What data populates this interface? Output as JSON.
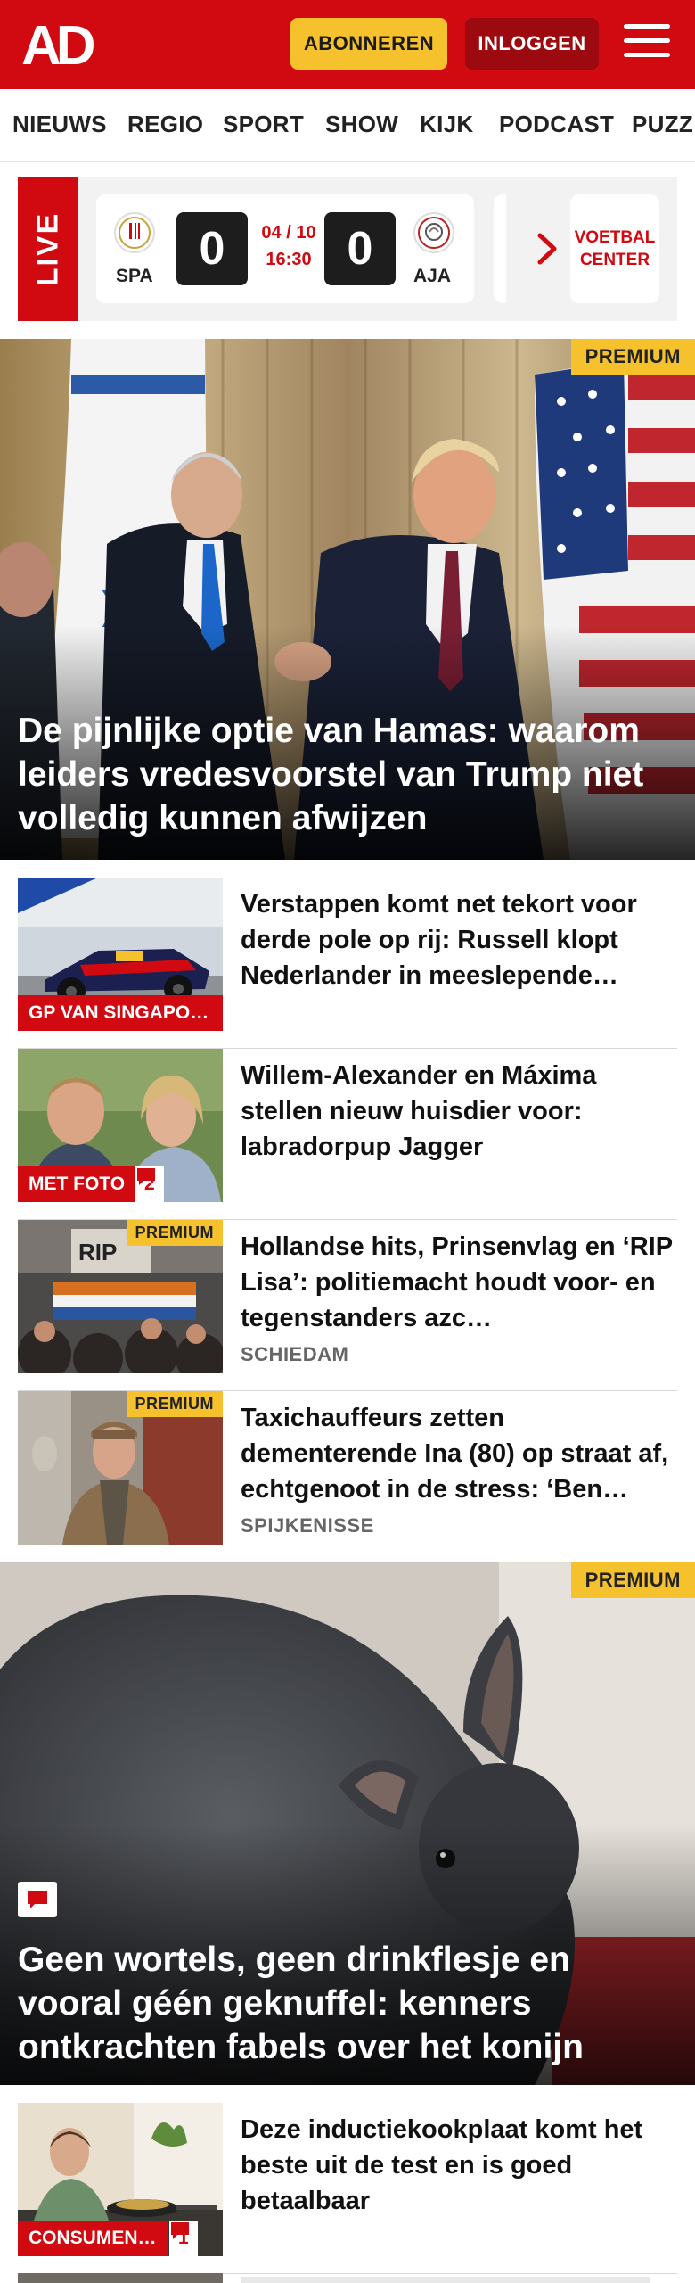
{
  "header": {
    "logo_text": "AD",
    "subscribe_label": "ABONNEREN",
    "login_label": "INLOGGEN",
    "menu_icon": "hamburger-menu-icon",
    "brand_color": "#d10a11",
    "accent_color": "#f5c22e"
  },
  "nav": {
    "items": [
      "NIEUWS",
      "REGIO",
      "SPORT",
      "SHOW",
      "KIJK",
      "PODCAST",
      "PUZZ"
    ]
  },
  "live": {
    "tab_label": "LIVE",
    "match": {
      "home": "SPA",
      "away": "AJA",
      "home_score": "0",
      "away_score": "0",
      "date": "04 / 10",
      "time": "16:30"
    },
    "football_center_label": "VOETBAL CENTER"
  },
  "hero": {
    "badge": "PREMIUM",
    "title": "De pijnlijke optie van Hamas: waarom leiders vredesvoorstel van Trump niet volledig kunnen afwijzen"
  },
  "articles": [
    {
      "title": "Verstappen komt net tekort voor derde pole op rij: Russell klopt Nederlander in meeslepende…",
      "label": "GP VAN SINGAPO…",
      "premium": "",
      "comments": "",
      "location": ""
    },
    {
      "title": "Willem-Alexander en Máxima stellen nieuw huisdier voor: labradorpup Jagger",
      "label": "MET FOTO",
      "premium": "",
      "comments": "2",
      "location": ""
    },
    {
      "title": "Hollandse hits, Prinsenvlag en ‘RIP Lisa’: politiemacht houdt voor- en tegenstanders azc…",
      "label": "",
      "premium": "PREMIUM",
      "comments": "",
      "location": "SCHIEDAM"
    },
    {
      "title": "Taxichauffeurs zetten dementerende Ina (80) op straat af, echtgenoot in de stress: ‘Ben…",
      "label": "",
      "premium": "PREMIUM",
      "comments": "",
      "location": "SPIJKENISSE"
    }
  ],
  "hero2": {
    "badge": "PREMIUM",
    "title": "Geen wortels, geen drinkflesje en vooral géén geknuffel: kenners ontkrachten fabels over het konijn"
  },
  "article_last": {
    "title": "Deze inductiekookplaat komt het beste uit de test en is goed betaalbaar",
    "label": "CONSUMEN…",
    "comments": "1"
  }
}
